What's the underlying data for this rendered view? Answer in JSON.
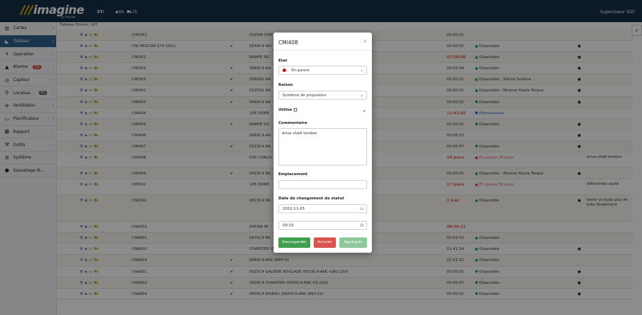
{
  "topbar": {
    "logo": "imagine",
    "logo_sub": "by Maplab",
    "site": "ST:",
    "person_count": "64",
    "vehicle_count": "75",
    "user": "Superviseur SDC"
  },
  "sidebar": {
    "items": [
      {
        "label": "Cartes",
        "icon": "map-icon"
      },
      {
        "label": "Tableau",
        "icon": "table-icon"
      },
      {
        "label": "Opération",
        "icon": "bolt-icon"
      },
      {
        "label": "Alarme",
        "icon": "bell-icon",
        "badge": "12"
      },
      {
        "label": "Capteur",
        "icon": "sensor-icon"
      },
      {
        "label": "Localisa...",
        "icon": "pin-icon",
        "badge": "85"
      },
      {
        "label": "Ventilation",
        "icon": "fan-icon"
      },
      {
        "label": "Planificateur",
        "icon": "calendar-icon"
      },
      {
        "label": "Rapport",
        "icon": "chart-icon"
      },
      {
        "label": "Outils",
        "icon": "wrench-icon"
      },
      {
        "label": "Système",
        "icon": "gears-icon"
      },
      {
        "label": "Sauvetage M...",
        "icon": "rescue-icon"
      }
    ]
  },
  "table": {
    "found_label": "Tableau Trouvé: 147",
    "rows": [
      {
        "name": "CHR352",
        "check": "",
        "location": "0325W STAT",
        "time": "00:00:01",
        "status": "",
        "status_color": "",
        "car": "",
        "comment": ""
      },
      {
        "name": "CNI PROCON 273 (002)",
        "check": "✔",
        "location": "0540C4 RAI",
        "time": "00:00:00",
        "status": "Disponible",
        "status_color": "green",
        "car": "●",
        "comment": ""
      },
      {
        "name": "CMI301",
        "check": "",
        "location": "RAMPE SIC",
        "time": "07:28:08",
        "status": "Disponible",
        "status_color": "green",
        "car": "●",
        "comment": "",
        "time_red": true
      },
      {
        "name": "CMI302",
        "check": "✔",
        "location": "0660C4-AN",
        "time": "00:02:04",
        "status": "Disponible",
        "status_color": "green",
        "car": "●",
        "comment": ""
      },
      {
        "name": "CMI303",
        "check": "✔",
        "location": "0060SG RA",
        "time": "00:00:01",
        "status": "Disponible - Stérile Surface",
        "status_color": "green",
        "car": "●",
        "comment": ""
      },
      {
        "name": "CMI401",
        "check": "✔",
        "location": "0125SG RA",
        "time": "00:00:01",
        "status": "Disponible - Minerai Haute Teneur",
        "status_color": "green",
        "car": "●",
        "comment": ""
      },
      {
        "name": "CMI403",
        "check": "✔",
        "location": "0460C4 RA",
        "time": "00:00:02",
        "status": "Disponible",
        "status_color": "green",
        "car": "●",
        "comment": ""
      },
      {
        "name": "CMI404",
        "check": "",
        "location": "105 DOME",
        "time": "11:41:55",
        "status": "Maintenance",
        "status_color": "blue",
        "car": "",
        "comment": "",
        "time_red": true
      },
      {
        "name": "CMI405",
        "check": "✔",
        "location": "RAMPE SIC",
        "time": "00:00:01",
        "status": "Disponible",
        "status_color": "green",
        "car": "●",
        "comment": ""
      },
      {
        "name": "CMI406",
        "check": "",
        "location": "0660C4-AN",
        "time": "00:06:33",
        "status": "",
        "status_color": "",
        "car": "●",
        "comment": ""
      },
      {
        "name": "CMI407",
        "check": "✔",
        "location": "0515C4 RA",
        "time": "00:00:07",
        "status": "Disponible",
        "status_color": "green",
        "car": "●",
        "comment": ""
      },
      {
        "name": "CMI408",
        "check": "",
        "location": "030 CONCA",
        "time": "24 Jours",
        "status": "En panne 29 Jours",
        "status_color": "red",
        "car": "",
        "comment": "drive shaft tomber",
        "time_red": true
      },
      {
        "name": "CMI409",
        "check": "✔",
        "location": "0415C4 RA",
        "time": "00:00:01",
        "status": "Disponible - Minerai Haute Teneur",
        "status_color": "green",
        "car": "●",
        "comment": ""
      },
      {
        "name": "CMI501",
        "check": "",
        "location": "105 DOME",
        "time": "17 Jours",
        "status": "En panne 58 Jours",
        "status_color": "red",
        "car": "",
        "comment": "differentiel sauté",
        "time_red": true
      },
      {
        "name": "CNA301",
        "check": "",
        "location": "0615C4 RA",
        "time": "1 Jour",
        "status": "Disponible",
        "status_color": "green",
        "car": "●",
        "comment": "tester pi avais pas de fuite finalement",
        "time_red": true
      },
      {
        "name": "CNA302",
        "check": "",
        "location": "0450W MI",
        "time": "08:36:22",
        "status": "",
        "status_color": "",
        "car": "",
        "comment": "",
        "time_red": true
      },
      {
        "name": "CNA601",
        "check": "",
        "location": "0475C4 RA",
        "time": "00:59:15",
        "status": "Disponible",
        "status_color": "green",
        "car": "",
        "comment": ""
      },
      {
        "name": "CNA602",
        "check": "",
        "location": "CHANTIER (0475C4-AHC-PS-355)",
        "time": "01:41:14",
        "status": "Disponible",
        "status_color": "green",
        "car": "●",
        "comment": ""
      },
      {
        "name": "CNA603",
        "check": "✔",
        "location": "0660C4-ANC-RMP-01",
        "time": "01:01:31",
        "status": "Disponible",
        "status_color": "green",
        "car": "",
        "comment": ""
      },
      {
        "name": "CNA801",
        "check": "✔",
        "location": "0525C4 GALERIE ROULAGE (0525C4-ANC-GRO-230)",
        "time": "00:00:01",
        "status": "Disponible",
        "status_color": "green",
        "car": "●",
        "comment": ""
      },
      {
        "name": "CNA802",
        "check": "✔",
        "location": "0500C4 CHANTIER (0500C4-ANC-PS-230)",
        "time": "00:00:47",
        "status": "Disponible",
        "status_color": "green",
        "car": "●",
        "comment": ""
      },
      {
        "name": "CNA804",
        "check": "✔",
        "location": "0600C4 NIVEAU (0600C4-ANC-ANV-01)",
        "time": "00:00:01",
        "status": "Disponible",
        "status_color": "green",
        "car": "●",
        "comment": ""
      }
    ]
  },
  "modal": {
    "title": "CMI408",
    "close": "×",
    "state_label": "État",
    "state_value": "En panne",
    "reason_label": "Raison",
    "reason_value": "Système de propulsion",
    "used_label": "Utilisé",
    "comment_label": "Commentaire",
    "comment_value": "drive shaft tomber",
    "location_label": "Emplacement",
    "location_value": "",
    "date_label": "Date de changement de statut",
    "date_value": "2022-11-05",
    "time_value": "09:16",
    "save_label": "Sauvegarder",
    "cancel_label": "Annuler",
    "apply_label": "Appliquer"
  },
  "colors": {
    "topbar": "#17314a",
    "sidebar_active": "#2f5f8c",
    "save": "#3f9f4f",
    "cancel": "#d9534f",
    "apply": "#8dc99a",
    "state_dot": "#d9000f"
  }
}
